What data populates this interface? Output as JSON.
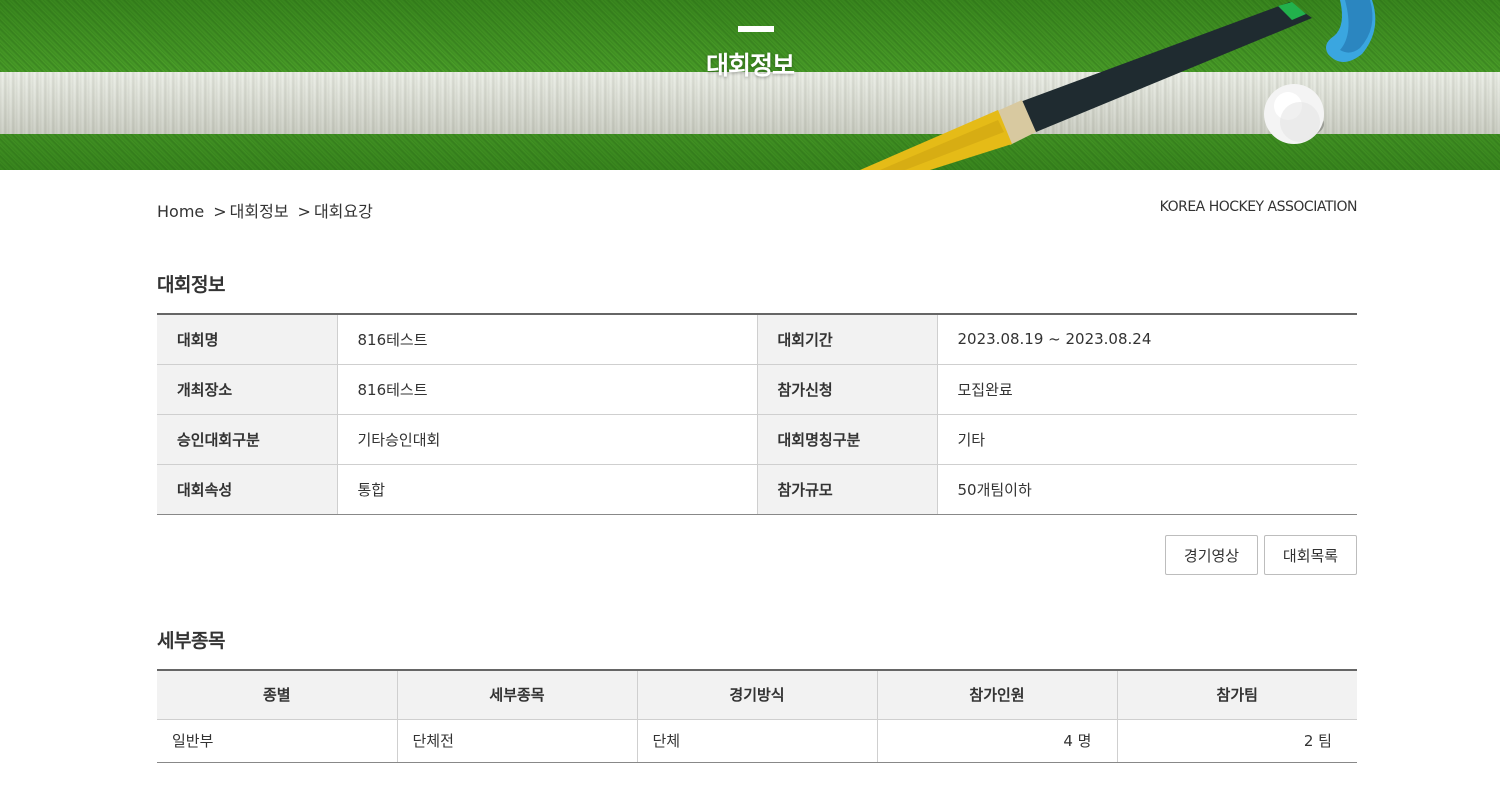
{
  "banner": {
    "title": "대회정보"
  },
  "breadcrumb": {
    "home": "Home",
    "sep1": ">",
    "level1": "대회정보",
    "sep2": ">",
    "level2": "대회요강"
  },
  "association": "KOREA HOCKEY ASSOCIATION",
  "info": {
    "heading": "대회정보",
    "rows": [
      {
        "label1": "대회명",
        "value1": "816테스트",
        "label2": "대회기간",
        "value2": "2023.08.19 ~ 2023.08.24"
      },
      {
        "label1": "개최장소",
        "value1": "816테스트",
        "label2": "참가신청",
        "value2": "모집완료"
      },
      {
        "label1": "승인대회구분",
        "value1": "기타승인대회",
        "label2": "대회명칭구분",
        "value2": "기타"
      },
      {
        "label1": "대회속성",
        "value1": "통합",
        "label2": "참가규모",
        "value2": "50개팀이하"
      }
    ]
  },
  "buttons": {
    "video": "경기영상",
    "list": "대회목록"
  },
  "detail": {
    "heading": "세부종목",
    "columns": [
      "종별",
      "세부종목",
      "경기방식",
      "참가인원",
      "참가팀"
    ],
    "rows": [
      {
        "division": "일반부",
        "event": "단체전",
        "method": "단체",
        "participants": "4 명",
        "teams": "2 팀"
      }
    ]
  },
  "colors": {
    "turf": "#4fa52b",
    "line": "#ecece6",
    "border_dark": "#666666",
    "header_bg": "#f2f2f2"
  },
  "icons": [
    "hockey-stick-graphic",
    "hockey-ball-graphic"
  ]
}
